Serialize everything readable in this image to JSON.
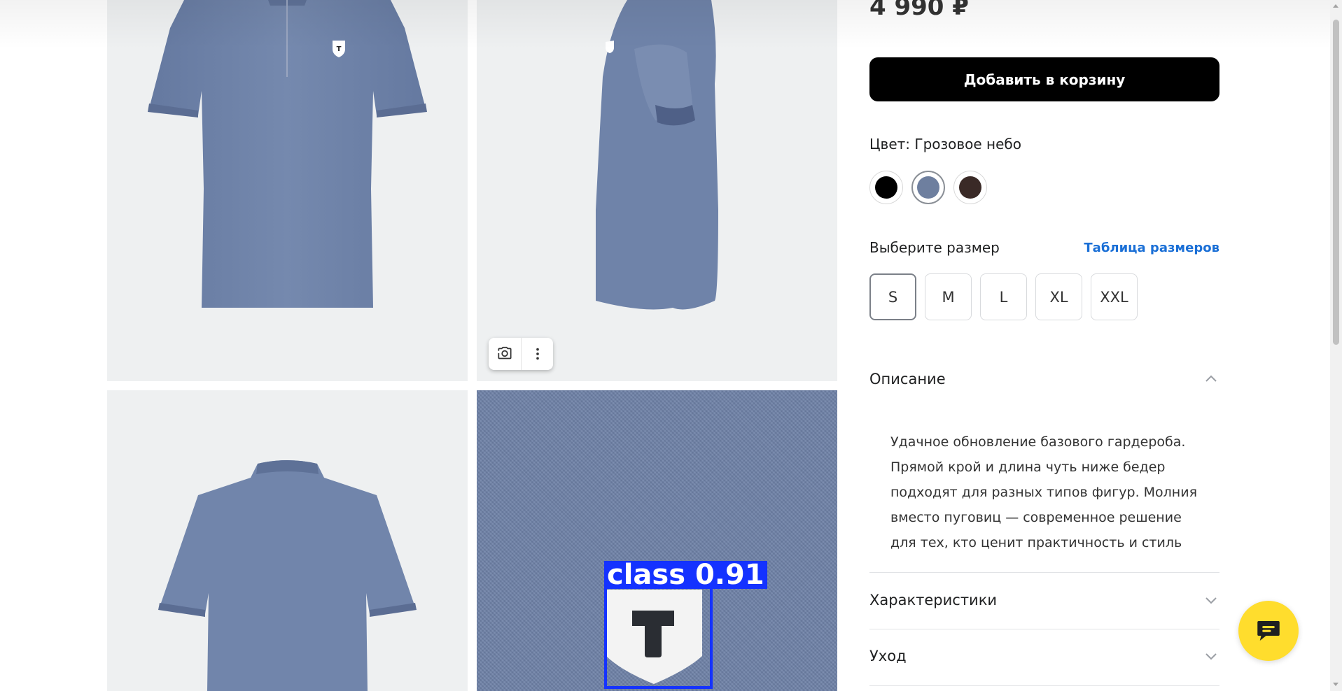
{
  "product": {
    "price": "4 990 ₽",
    "add_to_cart_label": "Добавить в корзину",
    "color_label": "Цвет: Грозовое небо",
    "colors": [
      {
        "name": "black",
        "hex": "#000000",
        "selected": false
      },
      {
        "name": "storm-sky",
        "hex": "#6e7f9f",
        "selected": true
      },
      {
        "name": "dark-brown",
        "hex": "#3a2a27",
        "selected": false
      }
    ],
    "size_label": "Выберите размер",
    "size_table_link": "Таблица размеров",
    "sizes": [
      "S",
      "M",
      "L",
      "XL",
      "XXL"
    ],
    "selected_size": "S"
  },
  "accordion": {
    "description_title": "Описание",
    "description_text": "Удачное обновление базового гардероба. Прямой крой и длина чуть ниже бедер подходят для разных типов фигур. Молния вместо пуговиц — современное решение для тех, кто ценит практичность и стиль",
    "specs_title": "Характеристики",
    "care_title": "Уход"
  },
  "detection": {
    "label": "class 0.91",
    "color": "#1432ff"
  },
  "colors": {
    "shirt": "#7084aa",
    "tile_bg": "#eef0f1",
    "link": "#1a6fd6",
    "chat": "#ffdd2d"
  }
}
